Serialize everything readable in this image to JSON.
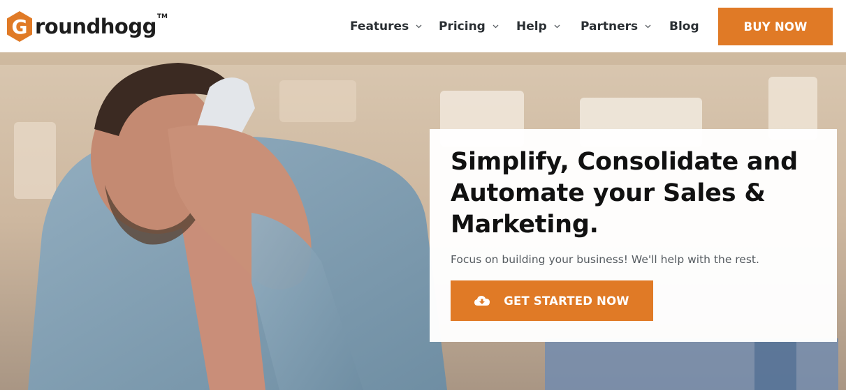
{
  "brand": {
    "name": "roundhogg",
    "logo_letter": "G",
    "trademark": "TM",
    "accent_color": "#e07a26"
  },
  "nav": {
    "items": [
      {
        "label": "Features",
        "has_dropdown": true
      },
      {
        "label": "Pricing",
        "has_dropdown": true
      },
      {
        "label": "Help",
        "has_dropdown": true
      },
      {
        "label": "Partners",
        "has_dropdown": true
      },
      {
        "label": "Blog",
        "has_dropdown": false
      }
    ],
    "buy_label": "BUY NOW"
  },
  "hero": {
    "headline": "Simplify, Consolidate and Automate your Sales & Marketing.",
    "subtext": "Focus on building your business! We'll help with the rest.",
    "cta_label": "GET STARTED NOW",
    "cta_icon": "cloud-download-icon"
  }
}
